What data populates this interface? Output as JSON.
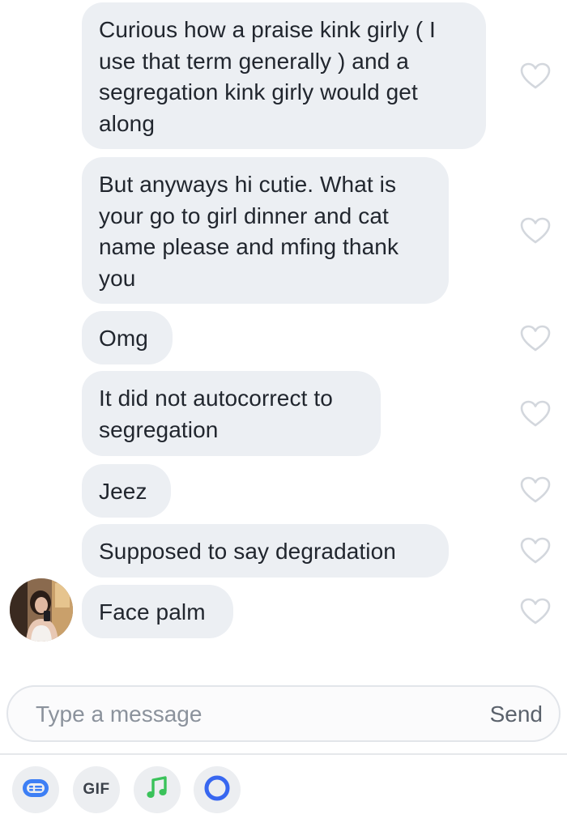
{
  "messages": [
    {
      "text": "Curious how a praise kink girly ( I use that term generally ) and a segregation kink girly would get along"
    },
    {
      "text": "But anyways hi cutie. What is your go to girl dinner and cat name please and mfing thank you"
    },
    {
      "text": "Omg"
    },
    {
      "text": "It did not autocorrect to segregation"
    },
    {
      "text": "Jeez"
    },
    {
      "text": "Supposed to say degradation"
    },
    {
      "text": "Face palm"
    }
  ],
  "composer": {
    "placeholder": "Type a message",
    "send_label": "Send"
  },
  "toolbar": {
    "gif_label": "GIF"
  },
  "colors": {
    "bubble": "#eceff3",
    "heart_outline": "#d3d7dd",
    "gif_icon_bg": "#eceef1",
    "sticker_icon": "#3d7ff5",
    "music_icon": "#3ac25a",
    "circle_icon": "#3867f0"
  },
  "icons": [
    "heart-icon",
    "sticker-icon",
    "gif-icon",
    "music-note-icon",
    "ring-icon"
  ]
}
